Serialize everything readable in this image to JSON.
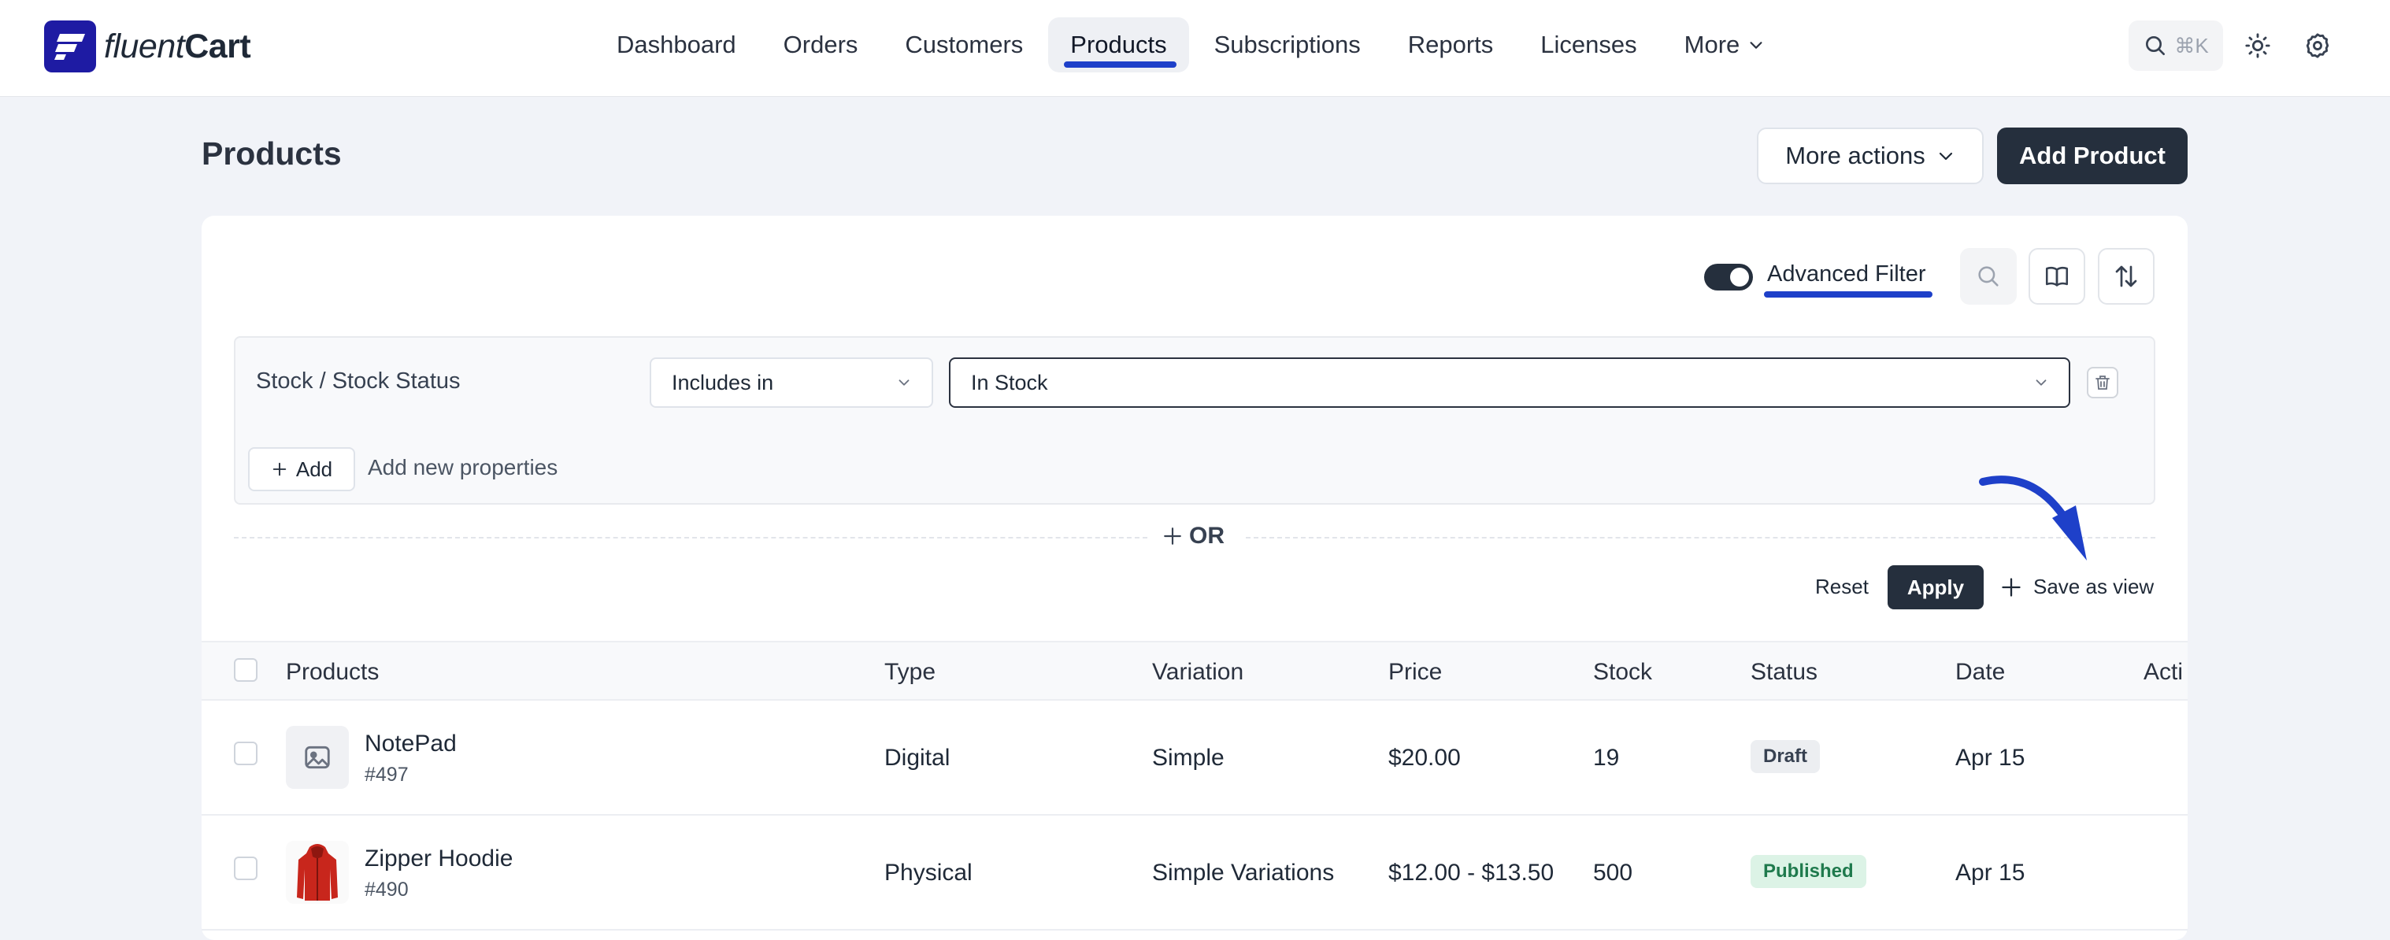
{
  "app": {
    "logo_part1": "fluent",
    "logo_part2": "Cart"
  },
  "nav": {
    "items": [
      "Dashboard",
      "Orders",
      "Customers",
      "Products",
      "Subscriptions",
      "Reports",
      "Licenses",
      "More"
    ],
    "active": "Products",
    "search_shortcut": "⌘K"
  },
  "header": {
    "title": "Products",
    "more_actions": "More actions",
    "add_product": "Add Product"
  },
  "filter": {
    "advanced_filter_label": "Advanced Filter",
    "advanced_filter_enabled": true,
    "property": "Stock / Stock Status",
    "operator": "Includes in",
    "value": "In Stock",
    "add_label": "Add",
    "add_new_properties": "Add new properties",
    "or_label": "OR",
    "reset": "Reset",
    "apply": "Apply",
    "save_as_view": "Save as view"
  },
  "table": {
    "columns": [
      "Products",
      "Type",
      "Variation",
      "Price",
      "Stock",
      "Status",
      "Date",
      "Acti"
    ],
    "rows": [
      {
        "name": "NotePad",
        "id": "#497",
        "type": "Digital",
        "variation": "Simple",
        "price": "$20.00",
        "stock": "19",
        "status": "Draft",
        "date": "Apr 15"
      },
      {
        "name": "Zipper Hoodie",
        "id": "#490",
        "type": "Physical",
        "variation": "Simple Variations",
        "price": "$12.00 - $13.50",
        "stock": "500",
        "status": "Published",
        "date": "Apr 15"
      }
    ]
  },
  "colors": {
    "brand": "#1e1ba3",
    "accent_underline": "#1e40c9",
    "dark_button": "#252f3d",
    "draft_badge_bg": "#eceef1",
    "published_badge_bg": "#dcf3e6",
    "published_badge_text": "#1f7a4d"
  }
}
